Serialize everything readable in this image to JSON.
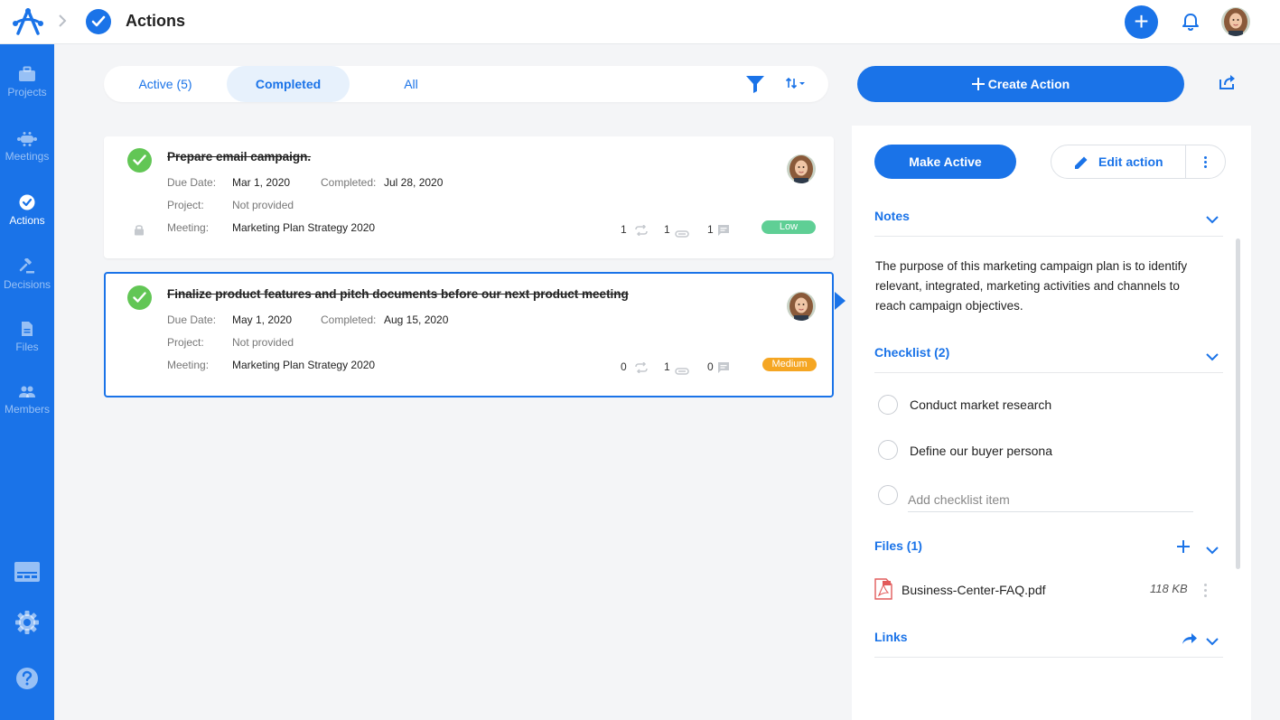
{
  "header": {
    "title": "Actions"
  },
  "sidebar": {
    "items": [
      {
        "label": "Projects"
      },
      {
        "label": "Meetings"
      },
      {
        "label": "Actions"
      },
      {
        "label": "Decisions"
      },
      {
        "label": "Files"
      },
      {
        "label": "Members"
      }
    ]
  },
  "tabs": [
    {
      "label": "Active (5)"
    },
    {
      "label": "Completed"
    },
    {
      "label": "All"
    }
  ],
  "toolbar": {
    "create_label": "Create Action"
  },
  "actions": [
    {
      "title": "Prepare email campaign.",
      "due_label": "Due Date:",
      "due": "Mar 1, 2020",
      "completed_label": "Completed:",
      "completed": "Jul 28, 2020",
      "project_label": "Project:",
      "project": "Not provided",
      "meeting_label": "Meeting:",
      "meeting": "Marketing Plan Strategy 2020",
      "repeat_count": "1",
      "attach_count": "1",
      "comment_count": "1",
      "priority": "Low",
      "priority_color": "#5fcf95"
    },
    {
      "title": "Finalize product features and pitch documents before our next product meeting",
      "due_label": "Due Date:",
      "due": "May 1, 2020",
      "completed_label": "Completed:",
      "completed": "Aug 15, 2020",
      "project_label": "Project:",
      "project": "Not provided",
      "meeting_label": "Meeting:",
      "meeting": "Marketing Plan Strategy 2020",
      "repeat_count": "0",
      "attach_count": "1",
      "comment_count": "0",
      "priority": "Medium",
      "priority_color": "#f5a623"
    }
  ],
  "detail": {
    "make_active_label": "Make Active",
    "edit_label": "Edit action",
    "notes": {
      "title": "Notes",
      "text": "The purpose of this marketing campaign plan is to identify relevant, integrated, marketing activities and channels to reach campaign objectives."
    },
    "checklist": {
      "title": "Checklist (2)",
      "items": [
        {
          "label": "Conduct market research"
        },
        {
          "label": "Define our buyer persona"
        }
      ],
      "add_placeholder": "Add checklist item"
    },
    "files": {
      "title": "Files (1)",
      "items": [
        {
          "name": "Business-Center-FAQ.pdf",
          "size": "118 KB"
        }
      ]
    },
    "links": {
      "title": "Links"
    }
  },
  "colors": {
    "brand": "#1a73e8",
    "done": "#62c655"
  }
}
